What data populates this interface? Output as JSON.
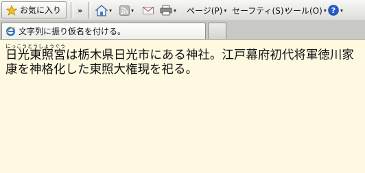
{
  "toolbar": {
    "favorites_label": "お気に入り",
    "overflow_chevron": "»",
    "page_label": "ページ(P)",
    "safety_label": "セーフティ(S)",
    "tools_label": "ツール(O)",
    "dropdown_arrow": "▾"
  },
  "tabs": [
    {
      "label": "文字列に振り仮名を付ける。",
      "active": true
    }
  ],
  "content": {
    "ruby_base": "日光東照宮",
    "ruby_text": "にっこうとうしょうぐう",
    "body_text": "は栃木県日光市にある神社。江戸幕府初代将軍徳川家康を神格化した東照大権現を祀る。"
  },
  "colors": {
    "page_background": "#fff9e1",
    "toolbar_background": "#e6e6e2",
    "tab_strip_background": "#c8c8c4",
    "help_icon": "#2a5ad6"
  },
  "icons": [
    "star-icon",
    "home-icon",
    "rss-feed-icon",
    "mail-icon",
    "printer-icon",
    "help-icon",
    "ie-page-icon"
  ]
}
